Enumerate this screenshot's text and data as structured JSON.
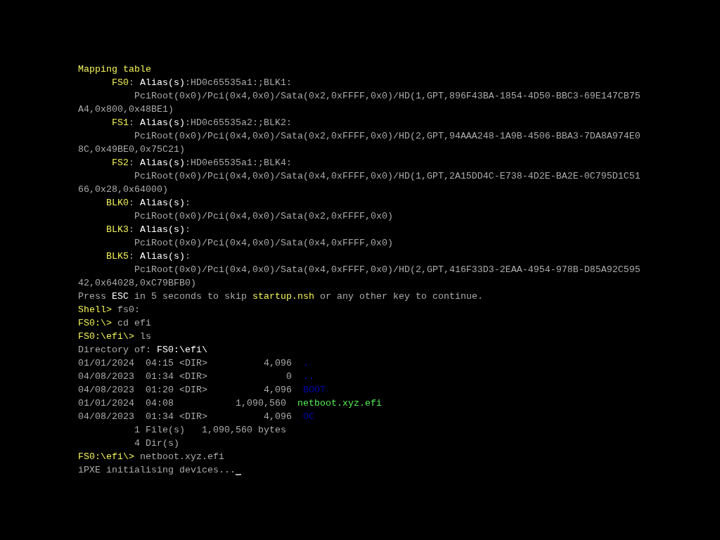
{
  "console": {
    "cursor": true,
    "lines": [
      {
        "segments": [
          {
            "text": "Mapping table",
            "color": "#f2f25a"
          }
        ]
      },
      {
        "segments": [
          {
            "text": "      FS0",
            "color": "#f2f25a"
          },
          {
            "text": ": "
          },
          {
            "text": "Alias(s)",
            "color": "#ffffff"
          },
          {
            "text": ":HD0c65535a1:;BLK1:",
            "color": "#aaaaaa"
          }
        ]
      },
      {
        "segments": [
          {
            "text": "          PciRoot(0x0)/Pci(0x4,0x0)/Sata(0x2,0xFFFF,0x0)/HD(1,GPT,896F43BA-1854-4D50-BBC3-69E147CB75",
            "color": "#aaaaaa"
          }
        ]
      },
      {
        "segments": [
          {
            "text": "A4,0x800,0x48BE1)",
            "color": "#aaaaaa"
          }
        ]
      },
      {
        "segments": [
          {
            "text": "      FS1",
            "color": "#f2f25a"
          },
          {
            "text": ": "
          },
          {
            "text": "Alias(s)",
            "color": "#ffffff"
          },
          {
            "text": ":HD0c65535a2:;BLK2:",
            "color": "#aaaaaa"
          }
        ]
      },
      {
        "segments": [
          {
            "text": "          PciRoot(0x0)/Pci(0x4,0x0)/Sata(0x2,0xFFFF,0x0)/HD(2,GPT,94AAA248-1A9B-4506-BBA3-7DA8A974E0",
            "color": "#aaaaaa"
          }
        ]
      },
      {
        "segments": [
          {
            "text": "8C,0x49BE0,0x75C21)",
            "color": "#aaaaaa"
          }
        ]
      },
      {
        "segments": [
          {
            "text": "      FS2",
            "color": "#f2f25a"
          },
          {
            "text": ": "
          },
          {
            "text": "Alias(s)",
            "color": "#ffffff"
          },
          {
            "text": ":HD0e65535a1:;BLK4:",
            "color": "#aaaaaa"
          }
        ]
      },
      {
        "segments": [
          {
            "text": "          PciRoot(0x0)/Pci(0x4,0x0)/Sata(0x4,0xFFFF,0x0)/HD(1,GPT,2A15DD4C-E738-4D2E-BA2E-0C795D1C51",
            "color": "#aaaaaa"
          }
        ]
      },
      {
        "segments": [
          {
            "text": "66,0x28,0x64000)",
            "color": "#aaaaaa"
          }
        ]
      },
      {
        "segments": [
          {
            "text": "     BLK0",
            "color": "#f2f25a"
          },
          {
            "text": ": "
          },
          {
            "text": "Alias(s)",
            "color": "#ffffff"
          },
          {
            "text": ":"
          }
        ]
      },
      {
        "segments": [
          {
            "text": "          PciRoot(0x0)/Pci(0x4,0x0)/Sata(0x2,0xFFFF,0x0)",
            "color": "#aaaaaa"
          }
        ]
      },
      {
        "segments": [
          {
            "text": "     BLK3",
            "color": "#f2f25a"
          },
          {
            "text": ": "
          },
          {
            "text": "Alias(s)",
            "color": "#ffffff"
          },
          {
            "text": ":"
          }
        ]
      },
      {
        "segments": [
          {
            "text": "          PciRoot(0x0)/Pci(0x4,0x0)/Sata(0x4,0xFFFF,0x0)",
            "color": "#aaaaaa"
          }
        ]
      },
      {
        "segments": [
          {
            "text": "     BLK5",
            "color": "#f2f25a"
          },
          {
            "text": ": "
          },
          {
            "text": "Alias(s)",
            "color": "#ffffff"
          },
          {
            "text": ":"
          }
        ]
      },
      {
        "segments": [
          {
            "text": "          PciRoot(0x0)/Pci(0x4,0x0)/Sata(0x4,0xFFFF,0x0)/HD(2,GPT,416F33D3-2EAA-4954-978B-D85A92C595",
            "color": "#aaaaaa"
          }
        ]
      },
      {
        "segments": [
          {
            "text": "42,0x64028,0xC79BFB0)",
            "color": "#aaaaaa"
          }
        ]
      },
      {
        "segments": [
          {
            "text": "Press ",
            "color": "#aaaaaa"
          },
          {
            "text": "ESC",
            "color": "#ffffff"
          },
          {
            "text": " in 5 seconds to skip ",
            "color": "#aaaaaa"
          },
          {
            "text": "startup.nsh",
            "color": "#f2f25a"
          },
          {
            "text": " or any other key to continue.",
            "color": "#aaaaaa"
          }
        ]
      },
      {
        "segments": [
          {
            "text": "Shell> ",
            "color": "#f2f25a"
          },
          {
            "text": "fs0:",
            "color": "#aaaaaa"
          }
        ]
      },
      {
        "segments": [
          {
            "text": "FS0:\\> ",
            "color": "#f2f25a"
          },
          {
            "text": "cd efi",
            "color": "#aaaaaa"
          }
        ]
      },
      {
        "segments": [
          {
            "text": "FS0:\\efi\\> ",
            "color": "#f2f25a"
          },
          {
            "text": "ls",
            "color": "#aaaaaa"
          }
        ]
      },
      {
        "segments": [
          {
            "text": "Directory of: ",
            "color": "#aaaaaa"
          },
          {
            "text": "FS0:\\efi\\",
            "color": "#ffffff"
          }
        ]
      },
      {
        "segments": [
          {
            "text": "01/01/2024  04:15 <DIR>          4,096  ",
            "color": "#aaaaaa"
          },
          {
            "text": ".",
            "color": "#0000aa",
            "kind": "small"
          }
        ]
      },
      {
        "segments": [
          {
            "text": "04/08/2023  01:34 <DIR>              0  ",
            "color": "#aaaaaa"
          },
          {
            "text": "..",
            "color": "#0000aa",
            "kind": "small"
          }
        ]
      },
      {
        "segments": [
          {
            "text": "04/08/2023  01:20 <DIR>          4,096  ",
            "color": "#aaaaaa"
          },
          {
            "text": "BOOT",
            "color": "#0000aa"
          }
        ]
      },
      {
        "segments": [
          {
            "text": "01/01/2024  04:08           1,090,560  ",
            "color": "#aaaaaa"
          },
          {
            "text": "netboot.xyz.efi",
            "color": "#55ee55"
          }
        ]
      },
      {
        "segments": [
          {
            "text": "04/08/2023  01:34 <DIR>          4,096  ",
            "color": "#aaaaaa"
          },
          {
            "text": "OC",
            "color": "#0000aa"
          }
        ]
      },
      {
        "segments": [
          {
            "text": "          1 File(s)   1,090,560 bytes",
            "color": "#aaaaaa"
          }
        ]
      },
      {
        "segments": [
          {
            "text": "          4 Dir(s)",
            "color": "#aaaaaa"
          }
        ]
      },
      {
        "segments": [
          {
            "text": "FS0:\\efi\\> ",
            "color": "#f2f25a"
          },
          {
            "text": "netboot.xyz.efi",
            "color": "#aaaaaa"
          }
        ]
      },
      {
        "segments": [
          {
            "text": "iPXE initialising devices...",
            "color": "#aaaaaa"
          }
        ]
      }
    ]
  }
}
